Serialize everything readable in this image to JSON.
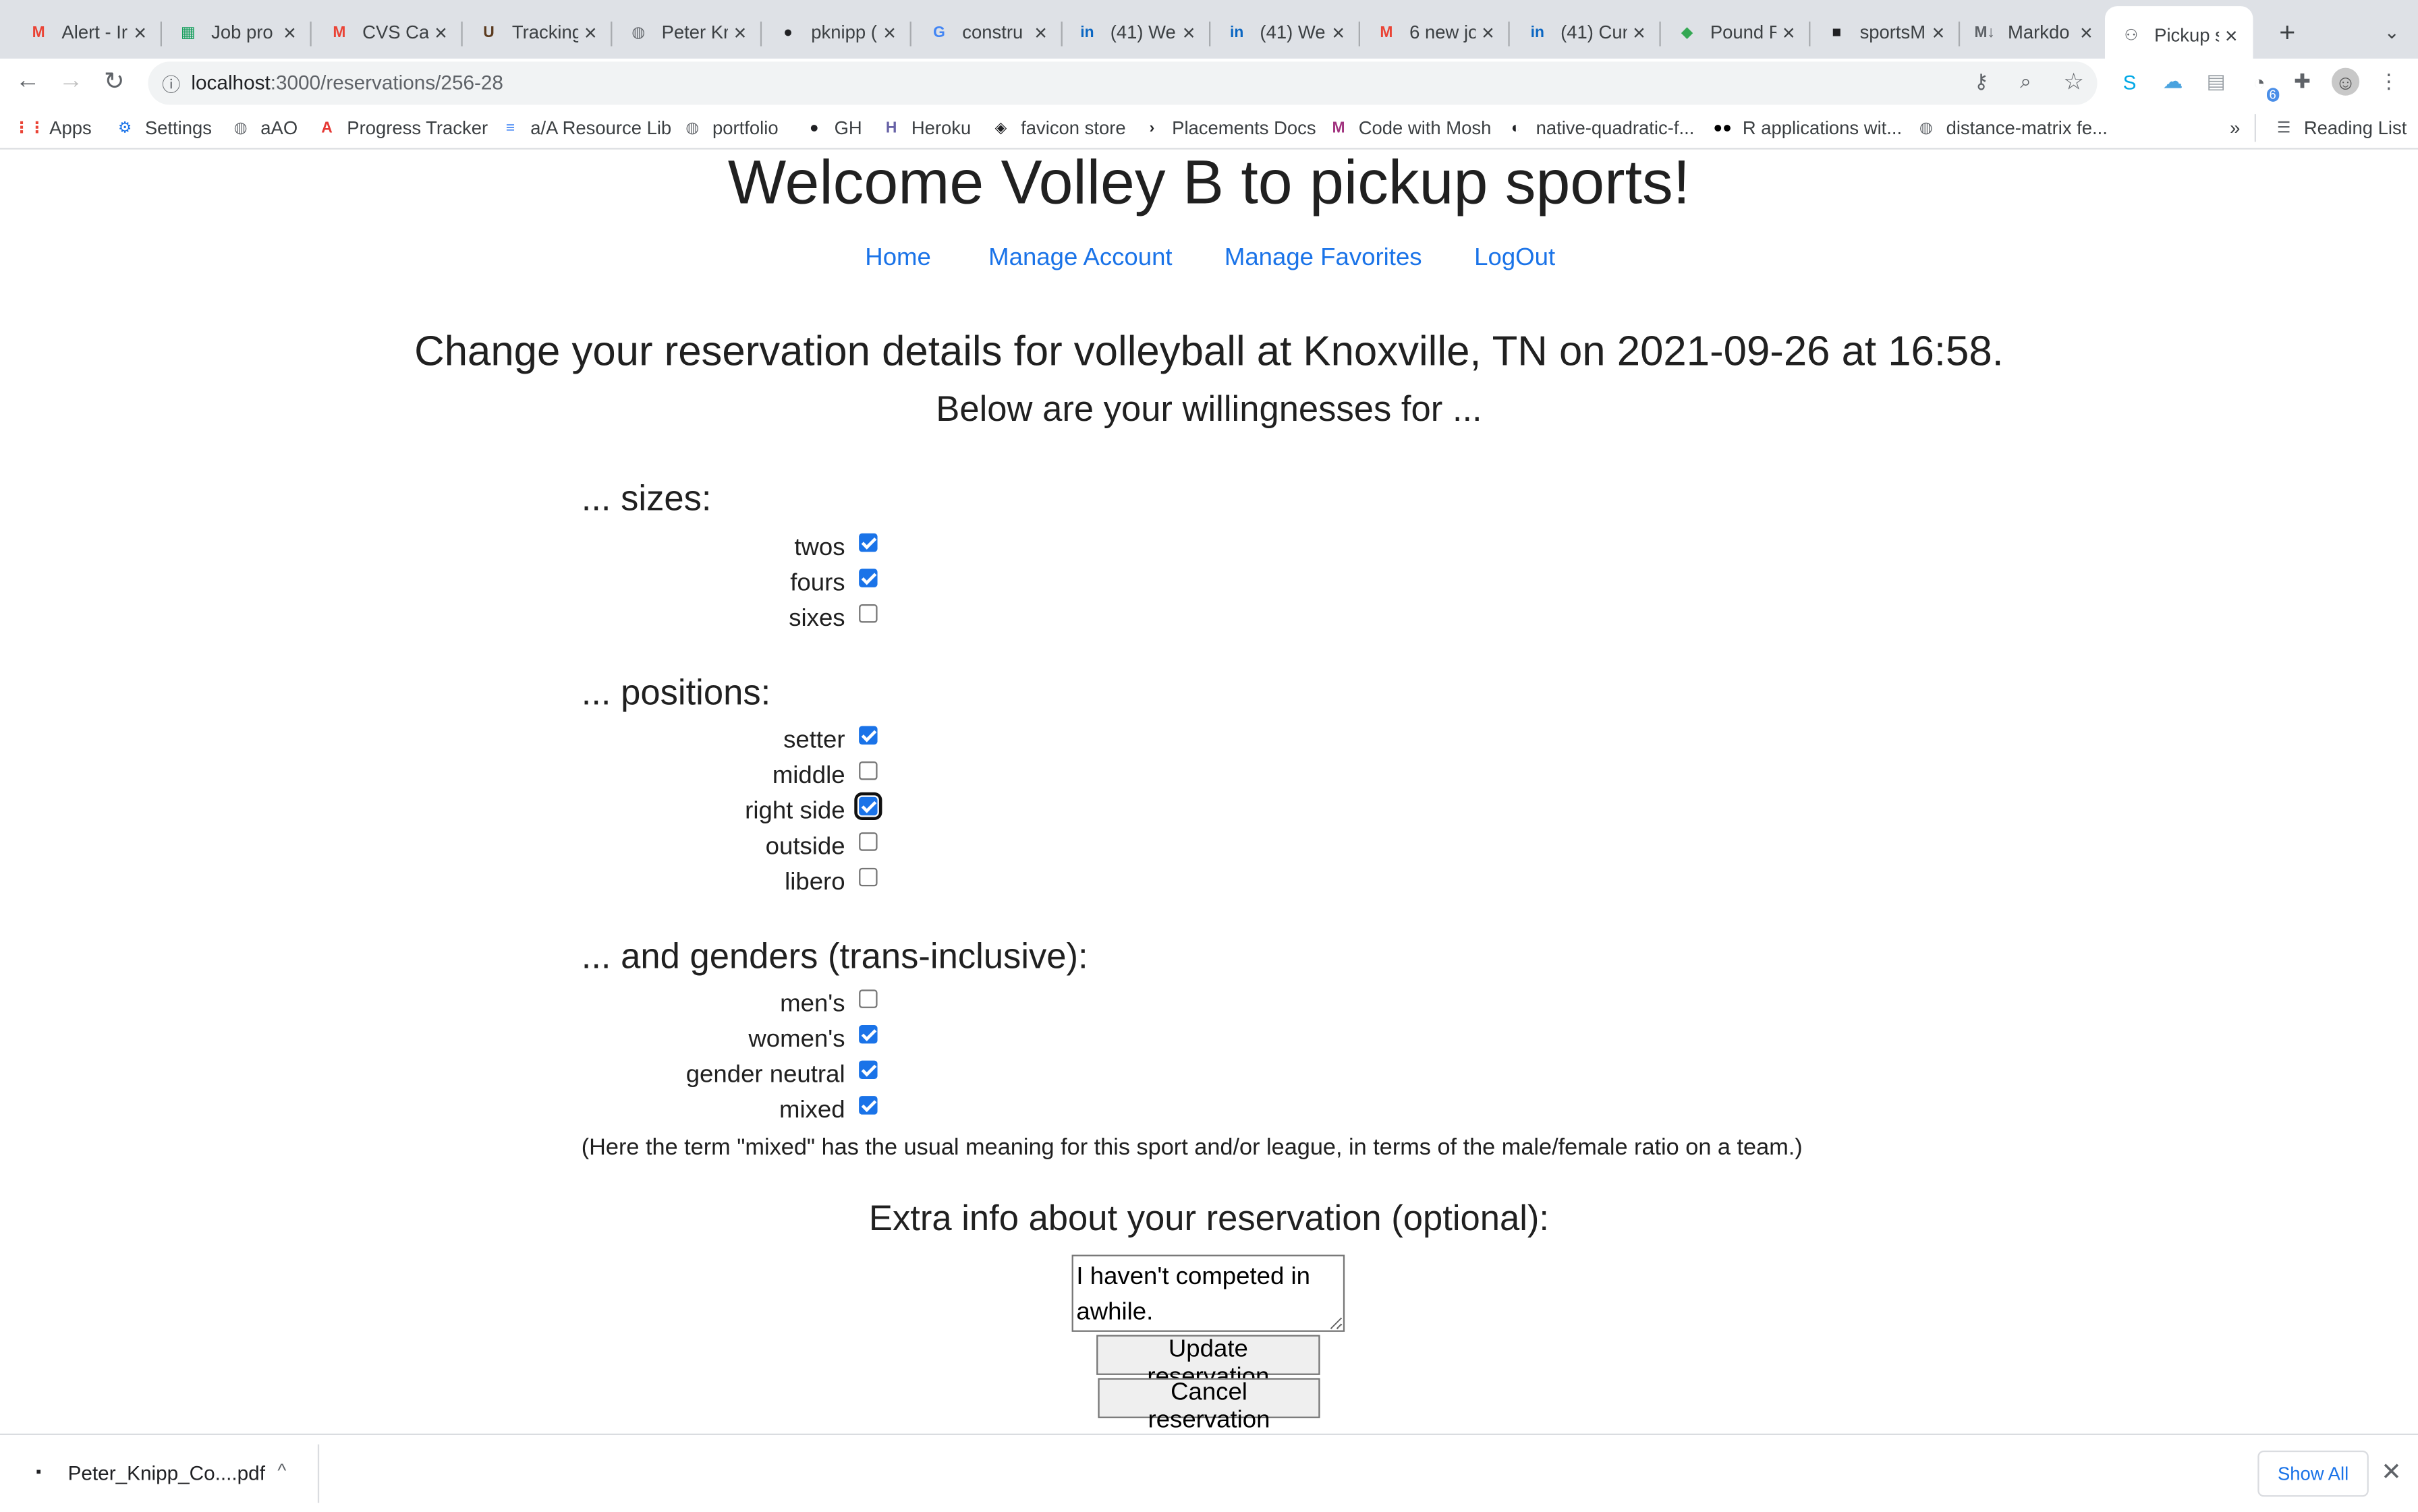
{
  "browser": {
    "tabs": [
      {
        "title": "Alert - Ir",
        "icon": "gmail-icon",
        "glyph": "M",
        "color": "#ea4335"
      },
      {
        "title": "Job pro",
        "icon": "sheets-icon",
        "glyph": "▦",
        "color": "#0f9d58"
      },
      {
        "title": "CVS Ca",
        "icon": "gmail-icon",
        "glyph": "M",
        "color": "#ea4335"
      },
      {
        "title": "Tracking",
        "icon": "ups-icon",
        "glyph": "U",
        "color": "#5b3a1e"
      },
      {
        "title": "Peter Kr",
        "icon": "globe-icon",
        "glyph": "◍",
        "color": "#5f6368"
      },
      {
        "title": "pknipp (",
        "icon": "github-icon",
        "glyph": "●",
        "color": "#202124"
      },
      {
        "title": "constru",
        "icon": "google-icon",
        "glyph": "G",
        "color": "#4285f4"
      },
      {
        "title": "(41) We",
        "icon": "linkedin-icon",
        "glyph": "in",
        "color": "#0a66c2"
      },
      {
        "title": "(41) We",
        "icon": "linkedin-icon",
        "glyph": "in",
        "color": "#0a66c2"
      },
      {
        "title": "6 new jo",
        "icon": "gmail-icon",
        "glyph": "M",
        "color": "#ea4335"
      },
      {
        "title": "(41) Cur",
        "icon": "linkedin-icon",
        "glyph": "in",
        "color": "#0a66c2"
      },
      {
        "title": "Pound R",
        "icon": "maps-icon",
        "glyph": "◆",
        "color": "#34a853"
      },
      {
        "title": "sportsM",
        "icon": "app-icon",
        "glyph": "■",
        "color": "#202124"
      },
      {
        "title": "Markdo",
        "icon": "markdown-icon",
        "glyph": "M↓",
        "color": "#5f6368"
      },
      {
        "title": "Pickup s",
        "icon": "pickup-icon",
        "glyph": "⚇",
        "color": "#5f6368",
        "active": true
      }
    ],
    "new_tab": "+",
    "url_host": "localhost",
    "url_path": ":3000/reservations/256-28",
    "extension_badge": "6",
    "bookmarks": [
      {
        "label": "Apps",
        "icon": "apps-icon",
        "glyph": "⋮⋮",
        "color": "#ea4335"
      },
      {
        "label": "Settings",
        "icon": "gear-icon",
        "glyph": "⚙",
        "color": "#1a73e8"
      },
      {
        "label": "aAO",
        "icon": "globe-icon",
        "glyph": "◍",
        "color": "#5f6368"
      },
      {
        "label": "Progress Tracker",
        "icon": "tracker-icon",
        "glyph": "A",
        "color": "#e53935"
      },
      {
        "label": "a/A Resource Lib",
        "icon": "docs-icon",
        "glyph": "≡",
        "color": "#4285f4"
      },
      {
        "label": "portfolio",
        "icon": "globe-icon",
        "glyph": "◍",
        "color": "#5f6368"
      },
      {
        "label": "GH",
        "icon": "github-icon",
        "glyph": "●",
        "color": "#202124"
      },
      {
        "label": "Heroku",
        "icon": "heroku-icon",
        "glyph": "H",
        "color": "#6762a6"
      },
      {
        "label": "favicon store",
        "icon": "favicon-icon",
        "glyph": "◈",
        "color": "#202124"
      },
      {
        "label": "Placements Docs",
        "icon": "terminal-icon",
        "glyph": "›",
        "color": "#202124"
      },
      {
        "label": "Code with Mosh",
        "icon": "mosh-icon",
        "glyph": "M",
        "color": "#a1337f"
      },
      {
        "label": "native-quadratic-f...",
        "icon": "replit-icon",
        "glyph": "◐",
        "color": "#202124"
      },
      {
        "label": "R applications wit...",
        "icon": "medium-icon",
        "glyph": "●●",
        "color": "#000000"
      },
      {
        "label": "distance-matrix fe...",
        "icon": "globe-icon",
        "glyph": "◍",
        "color": "#5f6368"
      }
    ],
    "bookmarks_overflow": "»",
    "reading_list": "Reading List"
  },
  "page": {
    "title": "Welcome Volley B to pickup sports!",
    "nav": [
      "Home",
      "Manage Account",
      "Manage Favorites",
      "LogOut"
    ],
    "heading": "Change your reservation details for volleyball at Knoxville, TN on  2021-09-26 at  16:58.",
    "subheading": "Below are your willingnesses for ...",
    "sections": [
      {
        "title": "... sizes:",
        "options": [
          {
            "label": "twos",
            "checked": true
          },
          {
            "label": "fours",
            "checked": true
          },
          {
            "label": "sixes",
            "checked": false
          }
        ]
      },
      {
        "title": "... positions:",
        "options": [
          {
            "label": "setter",
            "checked": true
          },
          {
            "label": "middle",
            "checked": false
          },
          {
            "label": "right side",
            "checked": true,
            "focused": true
          },
          {
            "label": "outside",
            "checked": false
          },
          {
            "label": "libero",
            "checked": false
          }
        ]
      },
      {
        "title": "... and genders (trans-inclusive):",
        "options": [
          {
            "label": "men's",
            "checked": false
          },
          {
            "label": "women's",
            "checked": true
          },
          {
            "label": "gender neutral",
            "checked": true
          },
          {
            "label": "mixed",
            "checked": true
          }
        ]
      }
    ],
    "note": "(Here the term \"mixed\" has the usual meaning for this sport and/or league, in terms of the male/female ratio on a team.)",
    "extra_title": "Extra info about your reservation (optional):",
    "extra_value": "I haven't competed in awhile.",
    "update_button": "Update reservation",
    "cancel_button": "Cancel reservation"
  },
  "downloads": {
    "file": "Peter_Knipp_Co....pdf",
    "show_all": "Show All"
  }
}
